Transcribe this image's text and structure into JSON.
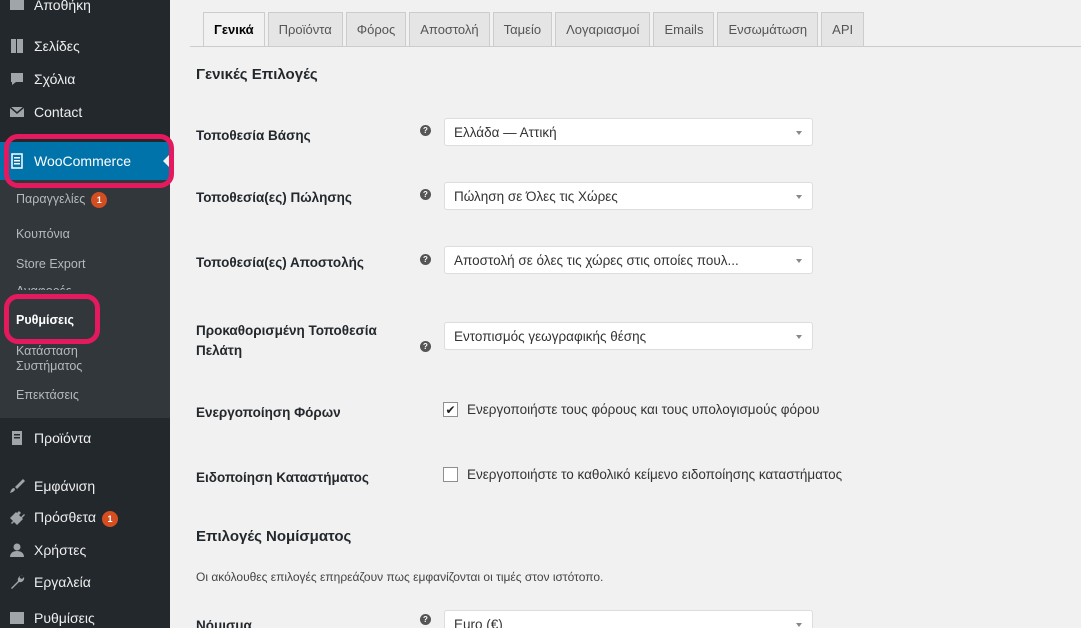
{
  "sidebar": {
    "items": [
      {
        "label": "Αποθήκη",
        "icon": "media-icon"
      },
      {
        "label": "Σελίδες",
        "icon": "pages-icon"
      },
      {
        "label": "Σχόλια",
        "icon": "comments-icon"
      },
      {
        "label": "Contact",
        "icon": "mail-icon"
      },
      {
        "label": "WooCommerce",
        "icon": "woocommerce-icon"
      },
      {
        "label": "Προϊόντα",
        "icon": "products-icon"
      },
      {
        "label": "Εμφάνιση",
        "icon": "appearance-icon"
      },
      {
        "label": "Πρόσθετα",
        "icon": "plugins-icon",
        "badge": "1"
      },
      {
        "label": "Χρήστες",
        "icon": "users-icon"
      },
      {
        "label": "Εργαλεία",
        "icon": "tools-icon"
      },
      {
        "label": "Ρυθμίσεις",
        "icon": "settings-icon"
      }
    ],
    "submenu": [
      {
        "label": "Παραγγελίες",
        "badge": "1"
      },
      {
        "label": "Κουπόνια"
      },
      {
        "label": "Store Export"
      },
      {
        "label": "Αναφορές"
      },
      {
        "label": "Ρυθμίσεις"
      },
      {
        "label": "Κατάσταση"
      },
      {
        "label": "Συστήματος"
      },
      {
        "label": "Επεκτάσεις"
      }
    ],
    "highlight_color": "#e5195e",
    "active_color": "#0073aa"
  },
  "tabs": [
    {
      "label": "Γενικά",
      "active": true
    },
    {
      "label": "Προϊόντα"
    },
    {
      "label": "Φόρος"
    },
    {
      "label": "Αποστολή"
    },
    {
      "label": "Ταμείο"
    },
    {
      "label": "Λογαριασμοί"
    },
    {
      "label": "Emails"
    },
    {
      "label": "Ενσωμάτωση"
    },
    {
      "label": "API"
    }
  ],
  "general": {
    "title": "Γενικές Επιλογές",
    "base_location": {
      "label": "Τοποθεσία Βάσης",
      "value": "Ελλάδα — Αττική"
    },
    "selling_location": {
      "label": "Τοποθεσία(ες) Πώλησης",
      "value": "Πώληση σε Όλες τις Χώρες"
    },
    "shipping_location": {
      "label": "Τοποθεσία(ες) Αποστολής",
      "value": "Αποστολή σε όλες τις χώρες στις οποίες πουλ..."
    },
    "default_customer_location": {
      "label_line1": "Προκαθορισμένη Τοποθεσία",
      "label_line2": "Πελάτη",
      "value": "Εντοπισμός γεωγραφικής θέσης"
    },
    "enable_taxes": {
      "label": "Ενεργοποίηση Φόρων",
      "text": "Ενεργοποιήστε τους φόρους και τους υπολογισμούς φόρου",
      "checked": true
    },
    "store_notice": {
      "label": "Ειδοποίηση Καταστήματος",
      "text": "Ενεργοποιήστε το καθολικό κείμενο ειδοποίησης καταστήματος",
      "checked": false
    }
  },
  "currency": {
    "title": "Επιλογές Νομίσματος",
    "description": "Οι ακόλουθες επιλογές επηρεάζουν πως εμφανίζονται οι τιμές στον ιστότοπο.",
    "currency_field": {
      "label": "Νόμισμα",
      "value": "Euro (€)"
    }
  },
  "help_glyph": "?",
  "check_glyph": "✔"
}
